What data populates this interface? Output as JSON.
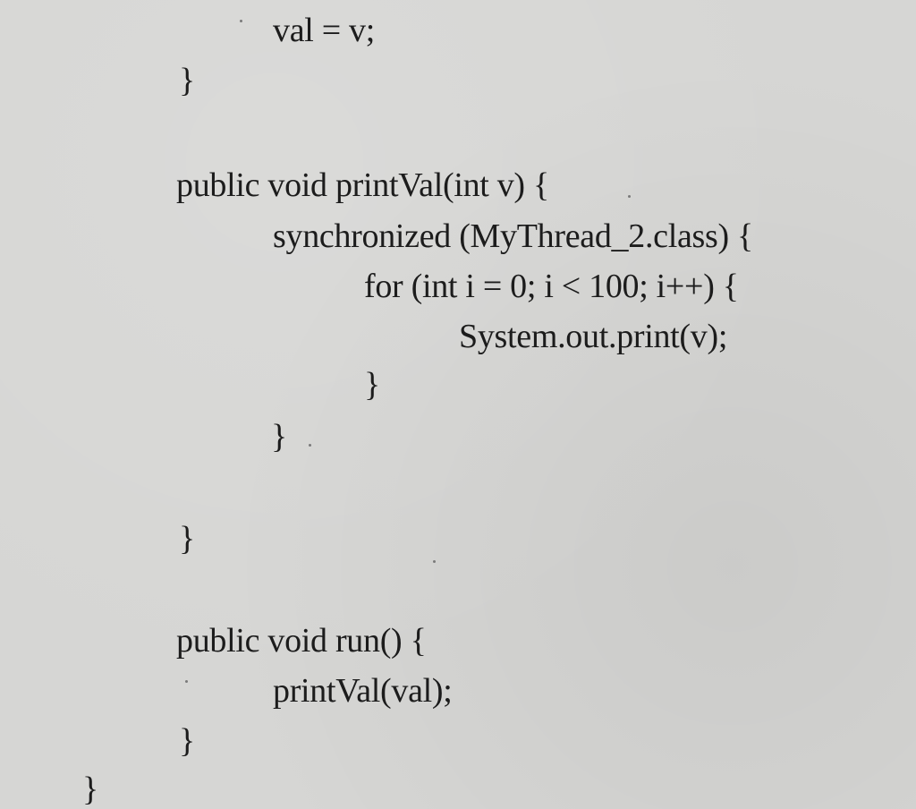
{
  "code": {
    "lines": [
      "val = v;",
      "}",
      "public void printVal(int v) {",
      "synchronized (MyThread_2.class) {",
      "for (int i = 0; i < 100; i++) {",
      "System.out.print(v);",
      "}",
      "}",
      "}",
      "public void run() {",
      "printVal(val);",
      "}",
      "}"
    ]
  }
}
